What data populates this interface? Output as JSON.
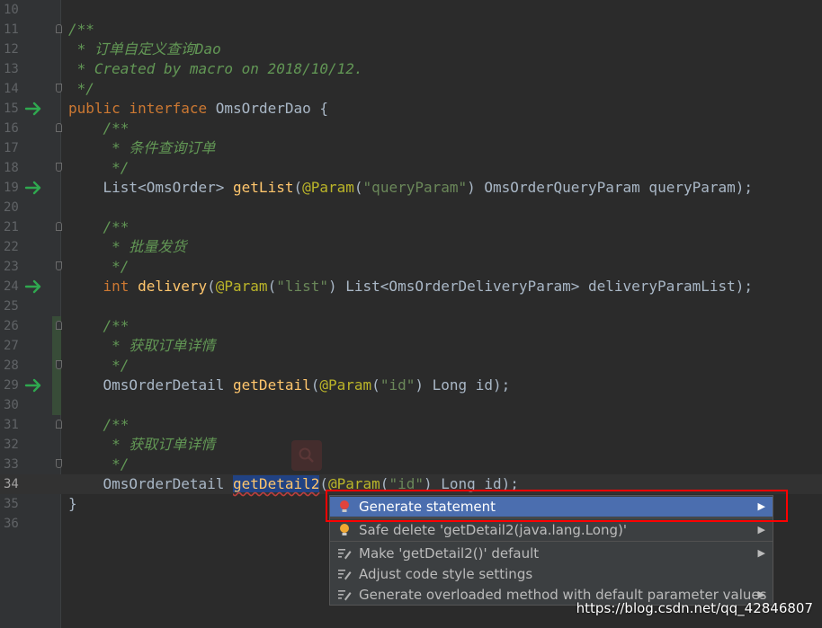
{
  "line_numbers": [
    "10",
    "11",
    "12",
    "13",
    "14",
    "15",
    "16",
    "17",
    "18",
    "19",
    "20",
    "21",
    "22",
    "23",
    "24",
    "25",
    "26",
    "27",
    "28",
    "29",
    "30",
    "31",
    "32",
    "33",
    "34",
    "35",
    "36"
  ],
  "code": {
    "l11": "/**",
    "l12": " * 订单自定义查询Dao",
    "l13": " * Created by macro on 2018/10/12.",
    "l14": " */",
    "l15_kw1": "public",
    "l15_kw2": "interface",
    "l15_rest": "OmsOrderDao {",
    "l16": "    /**",
    "l17": "     * 条件查询订单",
    "l18": "     */",
    "l19_type": "    List<OmsOrder> ",
    "l19_fn": "getList",
    "l19_p1": "(",
    "l19_ann": "@Param",
    "l19_p2": "(",
    "l19_str": "\"queryParam\"",
    "l19_rest": ") OmsOrderQueryParam queryParam);",
    "l21": "    /**",
    "l22": "     * 批量发货",
    "l23": "     */",
    "l24_kw": "    int ",
    "l24_fn": "delivery",
    "l24_p1": "(",
    "l24_ann": "@Param",
    "l24_p2": "(",
    "l24_str": "\"list\"",
    "l24_rest": ") List<OmsOrderDeliveryParam> deliveryParamList);",
    "l26": "    /**",
    "l27": "     * 获取订单详情",
    "l28": "     */",
    "l29_type": "    OmsOrderDetail ",
    "l29_fn": "getDetail",
    "l29_p1": "(",
    "l29_ann": "@Param",
    "l29_p2": "(",
    "l29_str": "\"id\"",
    "l29_rest": ") Long id);",
    "l31": "    /**",
    "l32": "     * 获取订单详情",
    "l33": "     */",
    "l34_type": "    OmsOrderDetail ",
    "l34_fn": "getDetail2",
    "l34_p1": "(",
    "l34_ann": "@Param",
    "l34_p2": "(",
    "l34_str": "\"id\"",
    "l34_rest": ") Long id);",
    "l35": "}"
  },
  "intention_menu": {
    "items": [
      {
        "label": "Generate statement",
        "icon": "red-bulb-icon",
        "submenu": true
      },
      {
        "label": "Safe delete 'getDetail2(java.lang.Long)'",
        "icon": "orange-bulb-icon",
        "submenu": true
      },
      {
        "label": "Make 'getDetail2()' default",
        "icon": "edit-icon",
        "submenu": true
      },
      {
        "label": "Adjust code style settings",
        "icon": "edit-icon",
        "submenu": false
      },
      {
        "label": "Generate overloaded method with default parameter values",
        "icon": "edit-icon",
        "submenu": true
      }
    ],
    "submenu_glyph": "▶"
  },
  "watermark": "https://blog.csdn.net/qq_42846807",
  "colors": {
    "background": "#2b2b2b",
    "keyword": "#cc7832",
    "comment": "#629755",
    "string": "#6a8759",
    "annotation": "#bbb529",
    "method": "#ffc66d",
    "menu_selected": "#4b6eaf",
    "highlight_box": "#ff0000"
  }
}
